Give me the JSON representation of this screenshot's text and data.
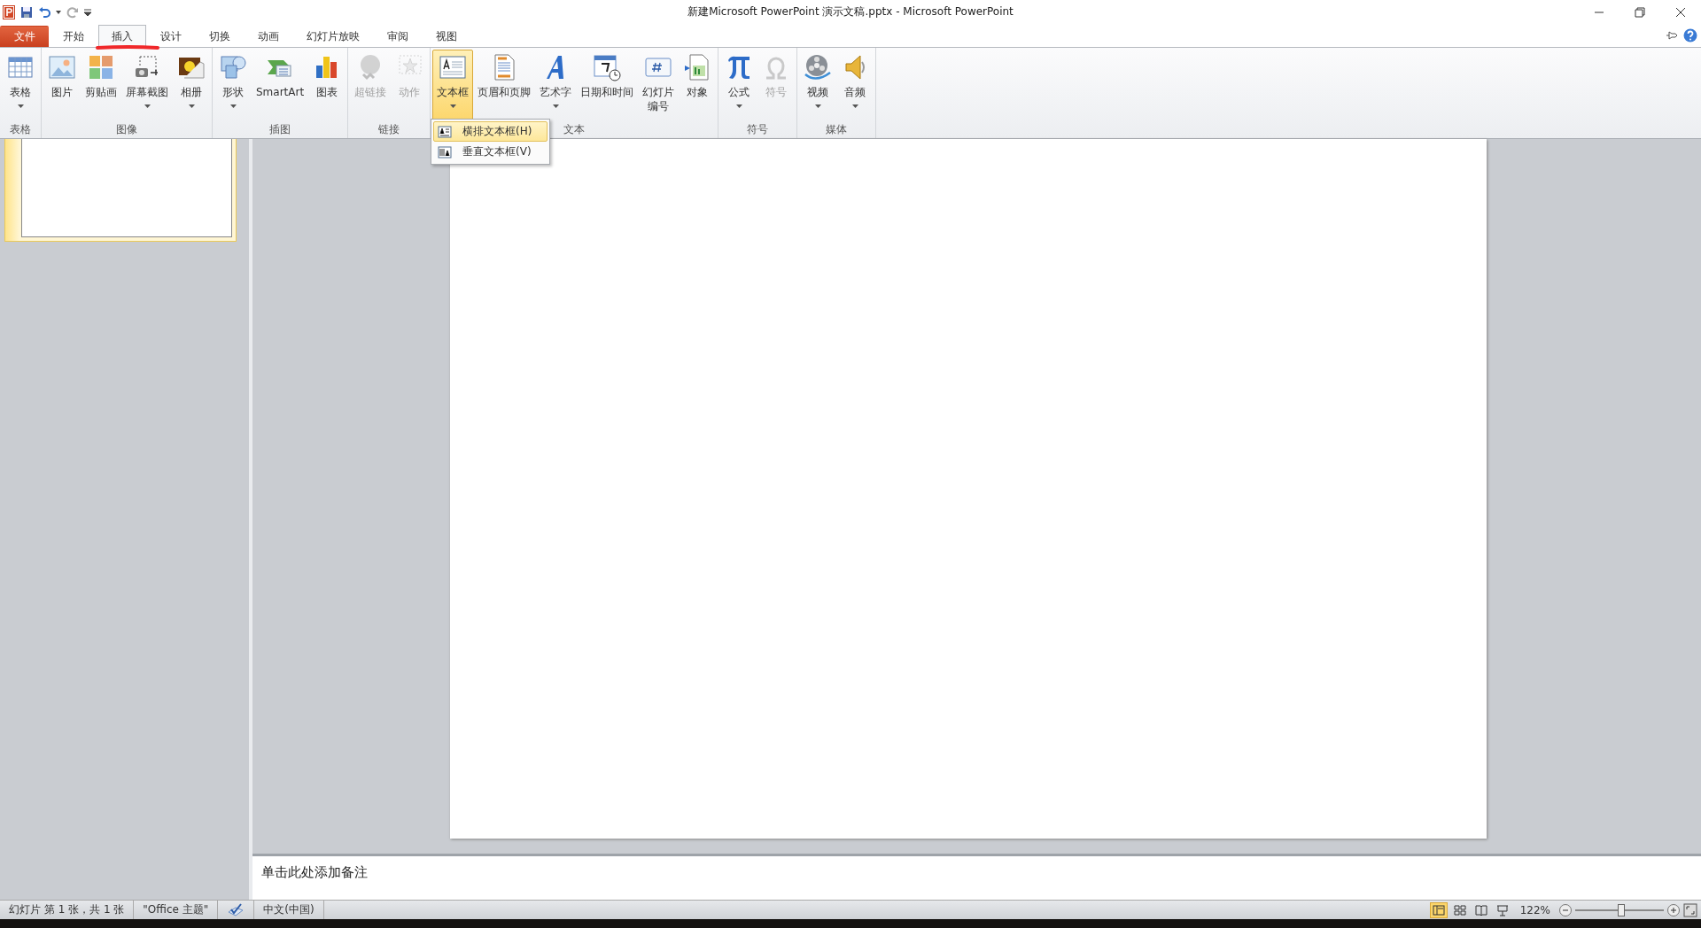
{
  "window": {
    "title": "新建Microsoft PowerPoint 演示文稿.pptx - Microsoft PowerPoint"
  },
  "tabs": [
    {
      "label": "文件",
      "kind": "file",
      "selected": false
    },
    {
      "label": "开始",
      "kind": "tab",
      "selected": false
    },
    {
      "label": "插入",
      "kind": "tab",
      "selected": true
    },
    {
      "label": "设计",
      "kind": "tab",
      "selected": false
    },
    {
      "label": "切换",
      "kind": "tab",
      "selected": false
    },
    {
      "label": "动画",
      "kind": "tab",
      "selected": false
    },
    {
      "label": "幻灯片放映",
      "kind": "tab",
      "selected": false
    },
    {
      "label": "审阅",
      "kind": "tab",
      "selected": false
    },
    {
      "label": "视图",
      "kind": "tab",
      "selected": false
    }
  ],
  "ribbon": {
    "groups": [
      {
        "label": "表格",
        "buttons": [
          {
            "label": "表格",
            "kind": "table",
            "dropdown": true,
            "disabled": false,
            "pressed": false,
            "wrap": false
          }
        ]
      },
      {
        "label": "图像",
        "buttons": [
          {
            "label": "图片",
            "kind": "picture",
            "dropdown": false,
            "disabled": false,
            "pressed": false,
            "wrap": false
          },
          {
            "label": "剪贴画",
            "kind": "clipart",
            "dropdown": false,
            "disabled": false,
            "pressed": false,
            "wrap": false
          },
          {
            "label": "屏幕截图",
            "kind": "screenshot",
            "dropdown": true,
            "disabled": false,
            "pressed": false,
            "wrap": false
          },
          {
            "label": "相册",
            "kind": "album",
            "dropdown": true,
            "disabled": false,
            "pressed": false,
            "wrap": false
          }
        ]
      },
      {
        "label": "插图",
        "buttons": [
          {
            "label": "形状",
            "kind": "shapes",
            "dropdown": true,
            "disabled": false,
            "pressed": false,
            "wrap": false
          },
          {
            "label": "SmartArt",
            "kind": "smartart",
            "dropdown": false,
            "disabled": false,
            "pressed": false,
            "wrap": false
          },
          {
            "label": "图表",
            "kind": "chart",
            "dropdown": false,
            "disabled": false,
            "pressed": false,
            "wrap": false
          }
        ]
      },
      {
        "label": "链接",
        "buttons": [
          {
            "label": "超链接",
            "kind": "hyperlink",
            "dropdown": false,
            "disabled": true,
            "pressed": false,
            "wrap": false
          },
          {
            "label": "动作",
            "kind": "action",
            "dropdown": false,
            "disabled": true,
            "pressed": false,
            "wrap": false
          }
        ]
      },
      {
        "label": "文本",
        "buttons": [
          {
            "label": "文本框",
            "kind": "textbox",
            "dropdown": true,
            "disabled": false,
            "pressed": true,
            "wrap": false
          },
          {
            "label": "页眉和页脚",
            "kind": "header",
            "dropdown": false,
            "disabled": false,
            "pressed": false,
            "wrap": false
          },
          {
            "label": "艺术字",
            "kind": "wordart",
            "dropdown": true,
            "disabled": false,
            "pressed": false,
            "wrap": false
          },
          {
            "label": "日期和时间",
            "kind": "datetime",
            "dropdown": false,
            "disabled": false,
            "pressed": false,
            "wrap": false
          },
          {
            "label": "幻灯片编号",
            "kind": "slidenumber",
            "dropdown": false,
            "disabled": false,
            "pressed": false,
            "wrap": true
          },
          {
            "label": "对象",
            "kind": "object",
            "dropdown": false,
            "disabled": false,
            "pressed": false,
            "wrap": false
          }
        ]
      },
      {
        "label": "符号",
        "buttons": [
          {
            "label": "公式",
            "kind": "equation",
            "dropdown": true,
            "disabled": false,
            "pressed": false,
            "wrap": false
          },
          {
            "label": "符号",
            "kind": "symbol",
            "dropdown": false,
            "disabled": true,
            "pressed": false,
            "wrap": false
          }
        ]
      },
      {
        "label": "媒体",
        "buttons": [
          {
            "label": "视频",
            "kind": "video",
            "dropdown": true,
            "disabled": false,
            "pressed": false,
            "wrap": false
          },
          {
            "label": "音频",
            "kind": "audio",
            "dropdown": true,
            "disabled": false,
            "pressed": false,
            "wrap": false
          }
        ]
      }
    ]
  },
  "textbox_menu": {
    "items": [
      {
        "label": "横排文本框(H)",
        "kind": "horizontal",
        "selected": true
      },
      {
        "label": "垂直文本框(V)",
        "kind": "vertical",
        "selected": false
      }
    ]
  },
  "thumbnails": [
    {
      "selected": true
    }
  ],
  "notes": {
    "placeholder": "单击此处添加备注"
  },
  "status_bar": {
    "slide_info": "幻灯片 第 1 张，共 1 张",
    "theme": "\"Office 主题\"",
    "language": "中文(中国)",
    "views": [
      {
        "kind": "normal",
        "selected": true
      },
      {
        "kind": "sorter",
        "selected": false
      },
      {
        "kind": "reading",
        "selected": false
      },
      {
        "kind": "show",
        "selected": false
      }
    ],
    "zoom": "122%",
    "zoom_slider": {
      "level": 0.52
    }
  }
}
